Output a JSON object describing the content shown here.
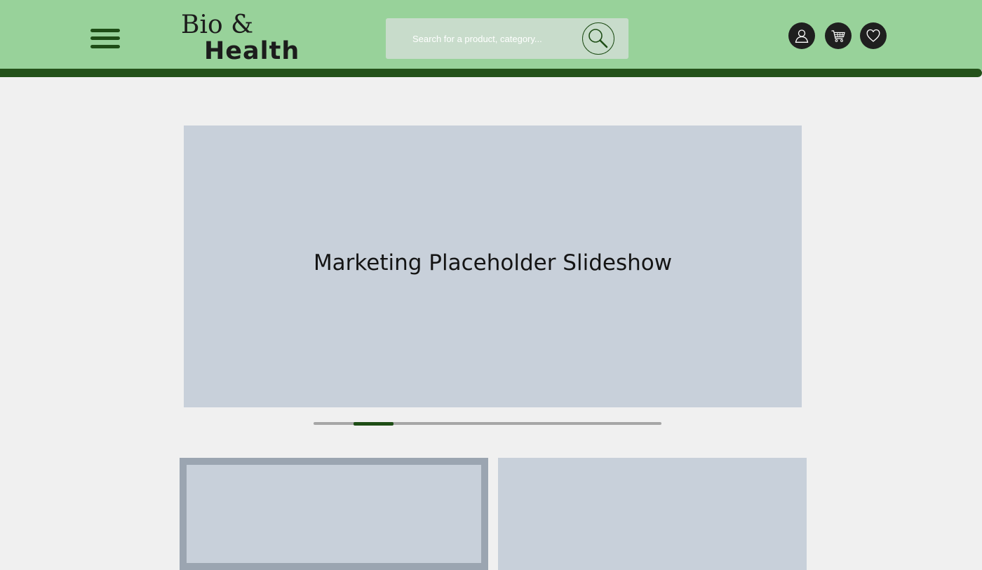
{
  "header": {
    "logo": {
      "line1": "Bio &",
      "line2": "Health"
    },
    "search": {
      "placeholder": "Search for a product, category..."
    },
    "icons": {
      "menu": "hamburger-menu-icon",
      "search": "magnifier-icon",
      "account": "user-icon",
      "cart": "cart-icon",
      "wishlist": "heart-icon"
    }
  },
  "slideshow": {
    "text": "Marketing Placeholder Slideshow",
    "progress": {
      "current_slide": 2,
      "total_slides": 9
    }
  },
  "colors": {
    "header_bg": "#98d29a",
    "accent": "#1e4d16",
    "page_bg": "#f0f0f0",
    "placeholder": "#c8d0da"
  }
}
